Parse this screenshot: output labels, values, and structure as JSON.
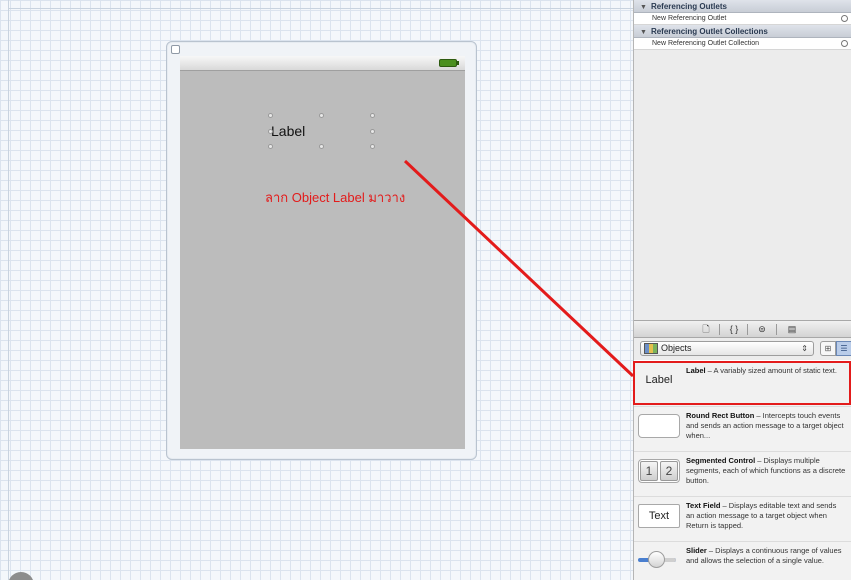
{
  "canvas": {
    "label_text": "Label",
    "annotation": "ลาก Object Label มาวาง",
    "annotation_color": "#e31b1b"
  },
  "connections": {
    "section_outlets": "Referencing Outlets",
    "new_outlet": "New Referencing Outlet",
    "section_collections": "Referencing Outlet Collections",
    "new_collection": "New Referencing Outlet Collection"
  },
  "library": {
    "tabs": [
      "file-template-icon",
      "code-snippet-icon",
      "objects-icon",
      "media-icon"
    ],
    "tab_glyphs": {
      "file": "🗋",
      "code": "{ }",
      "objects": "⊜",
      "media": "▤"
    },
    "filter": "Objects",
    "stepper": "⇕",
    "grid_btn": "⊞",
    "list_btn": "☰",
    "items": [
      {
        "thumb": "Label",
        "name": "Label",
        "desc": " – A variably sized amount of static text."
      },
      {
        "thumb": "",
        "name": "Round Rect Button",
        "desc": " – Intercepts touch events and sends an action message to a target object when..."
      },
      {
        "thumb": "",
        "seg1": "1",
        "seg2": "2",
        "name": "Segmented Control",
        "desc": " – Displays multiple segments, each of which functions as a discrete button."
      },
      {
        "thumb": "Text",
        "name": "Text Field",
        "desc": " – Displays editable text and sends an action message to a target object when Return is tapped."
      },
      {
        "thumb": "",
        "name": "Slider",
        "desc": " – Displays a continuous range of values and allows the selection of a single value."
      }
    ]
  }
}
